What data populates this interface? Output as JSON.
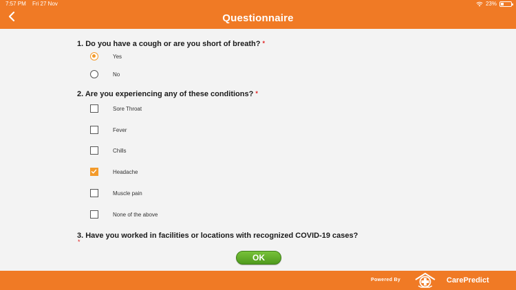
{
  "status_bar": {
    "time": "7:57 PM",
    "date": "Fri 27 Nov",
    "battery": "23%"
  },
  "header": {
    "title": "Questionnaire",
    "back_icon": "chevron-left-icon"
  },
  "questions": [
    {
      "label": "1. Do you have a cough or are you short of breath?",
      "required_mark": "*",
      "type": "radio",
      "options": [
        {
          "label": "Yes",
          "selected": true
        },
        {
          "label": "No",
          "selected": false
        }
      ]
    },
    {
      "label": "2. Are you experiencing any of these conditions?",
      "required_mark": "*",
      "type": "checkbox",
      "options": [
        {
          "label": "Sore Throat",
          "selected": false
        },
        {
          "label": "Fever",
          "selected": false
        },
        {
          "label": "Chills",
          "selected": false
        },
        {
          "label": "Headache",
          "selected": true
        },
        {
          "label": "Muscle pain",
          "selected": false
        },
        {
          "label": "None of the above",
          "selected": false
        }
      ]
    },
    {
      "label": "3. Have you worked in facilities or locations with recognized COVID-19 cases?",
      "required_mark": "*"
    }
  ],
  "ok_button": {
    "label": "OK"
  },
  "footer": {
    "powered_by": "Powered By",
    "brand": "CarePredict"
  },
  "colors": {
    "accent": "#f07a25",
    "selection": "#f39a2a",
    "ok_green": "#5ea726",
    "required": "#e02020"
  }
}
